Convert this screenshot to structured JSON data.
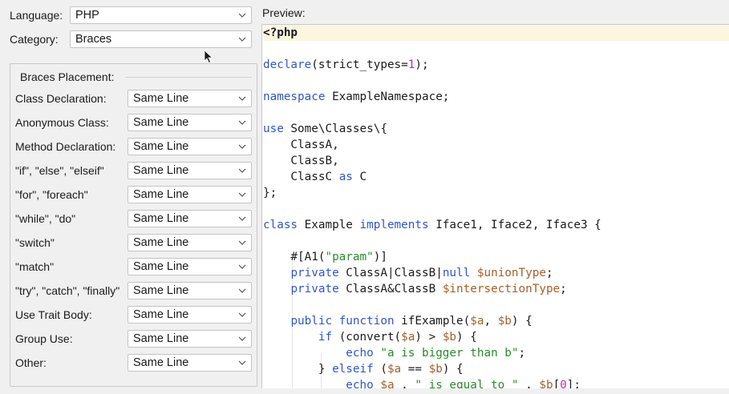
{
  "top": {
    "language_label": "Language:",
    "language_value": "PHP",
    "category_label": "Category:",
    "category_value": "Braces"
  },
  "group": {
    "title": "Braces Placement:",
    "rows": [
      {
        "label": "Class Declaration:",
        "value": "Same Line"
      },
      {
        "label": "Anonymous Class:",
        "value": "Same Line"
      },
      {
        "label": "Method Declaration:",
        "value": "Same Line"
      },
      {
        "label": "\"if\", \"else\", \"elseif\"",
        "value": "Same Line"
      },
      {
        "label": "\"for\", \"foreach\"",
        "value": "Same Line"
      },
      {
        "label": "\"while\", \"do\"",
        "value": "Same Line"
      },
      {
        "label": "\"switch\"",
        "value": "Same Line"
      },
      {
        "label": "\"match\"",
        "value": "Same Line"
      },
      {
        "label": "\"try\", \"catch\", \"finally\"",
        "value": "Same Line"
      },
      {
        "label": "Use Trait Body:",
        "value": "Same Line"
      },
      {
        "label": "Group Use:",
        "value": "Same Line"
      },
      {
        "label": "Other:",
        "value": "Same Line"
      }
    ]
  },
  "preview": {
    "label": "Preview:",
    "lines": [
      [
        {
          "t": "<?php",
          "c": "tag"
        }
      ],
      [],
      [
        {
          "t": "declare",
          "c": "kw"
        },
        {
          "t": "(strict_types="
        },
        {
          "t": "1",
          "c": "num"
        },
        {
          "t": ");"
        }
      ],
      [],
      [
        {
          "t": "namespace",
          "c": "kw"
        },
        {
          "t": " ExampleNamespace;"
        }
      ],
      [],
      [
        {
          "t": "use",
          "c": "kw"
        },
        {
          "t": " Some\\Classes\\{"
        }
      ],
      [
        {
          "t": "    ClassA,"
        }
      ],
      [
        {
          "t": "    ClassB,"
        }
      ],
      [
        {
          "t": "    ClassC "
        },
        {
          "t": "as",
          "c": "kw"
        },
        {
          "t": " C"
        }
      ],
      [
        {
          "t": "};"
        }
      ],
      [],
      [
        {
          "t": "class",
          "c": "kw"
        },
        {
          "t": " Example "
        },
        {
          "t": "implements",
          "c": "kw"
        },
        {
          "t": " Iface1, Iface2, Iface3 {"
        }
      ],
      [],
      [
        {
          "t": "    #[A1("
        },
        {
          "t": "\"param\"",
          "c": "str"
        },
        {
          "t": ")]"
        }
      ],
      [
        {
          "t": "    "
        },
        {
          "t": "private",
          "c": "kw"
        },
        {
          "t": " ClassA|ClassB|"
        },
        {
          "t": "null",
          "c": "kw"
        },
        {
          "t": " "
        },
        {
          "t": "$unionType",
          "c": "var"
        },
        {
          "t": ";"
        }
      ],
      [
        {
          "t": "    "
        },
        {
          "t": "private",
          "c": "kw"
        },
        {
          "t": " ClassA&ClassB "
        },
        {
          "t": "$intersectionType",
          "c": "var"
        },
        {
          "t": ";"
        }
      ],
      [],
      [
        {
          "t": "    "
        },
        {
          "t": "public",
          "c": "kw"
        },
        {
          "t": " "
        },
        {
          "t": "function",
          "c": "kw"
        },
        {
          "t": " ifExample("
        },
        {
          "t": "$a",
          "c": "var"
        },
        {
          "t": ", "
        },
        {
          "t": "$b",
          "c": "var"
        },
        {
          "t": ") {"
        }
      ],
      [
        {
          "t": "        "
        },
        {
          "t": "if",
          "c": "kw"
        },
        {
          "t": " (convert("
        },
        {
          "t": "$a",
          "c": "var"
        },
        {
          "t": ") > "
        },
        {
          "t": "$b",
          "c": "var"
        },
        {
          "t": ") {"
        }
      ],
      [
        {
          "t": "            "
        },
        {
          "t": "echo",
          "c": "kw"
        },
        {
          "t": " "
        },
        {
          "t": "\"a is bigger than b\"",
          "c": "str"
        },
        {
          "t": ";"
        }
      ],
      [
        {
          "t": "        } "
        },
        {
          "t": "elseif",
          "c": "kw"
        },
        {
          "t": " ("
        },
        {
          "t": "$a",
          "c": "var"
        },
        {
          "t": " == "
        },
        {
          "t": "$b",
          "c": "var"
        },
        {
          "t": ") {"
        }
      ],
      [
        {
          "t": "            "
        },
        {
          "t": "echo",
          "c": "kw"
        },
        {
          "t": " "
        },
        {
          "t": "$a",
          "c": "var"
        },
        {
          "t": " . "
        },
        {
          "t": "\" is equal to \"",
          "c": "str"
        },
        {
          "t": " . "
        },
        {
          "t": "$b",
          "c": "var"
        },
        {
          "t": "["
        },
        {
          "t": "0",
          "c": "num"
        },
        {
          "t": "];"
        }
      ]
    ]
  },
  "colors": {
    "keyword": "#2f57c8",
    "string": "#2a8a2a",
    "number": "#c227c2",
    "variable": "#a5602a",
    "current_line": "#fcf6df"
  },
  "icons": {
    "dropdown": "chevron-down-icon",
    "pointer": "mouse-pointer-icon"
  }
}
